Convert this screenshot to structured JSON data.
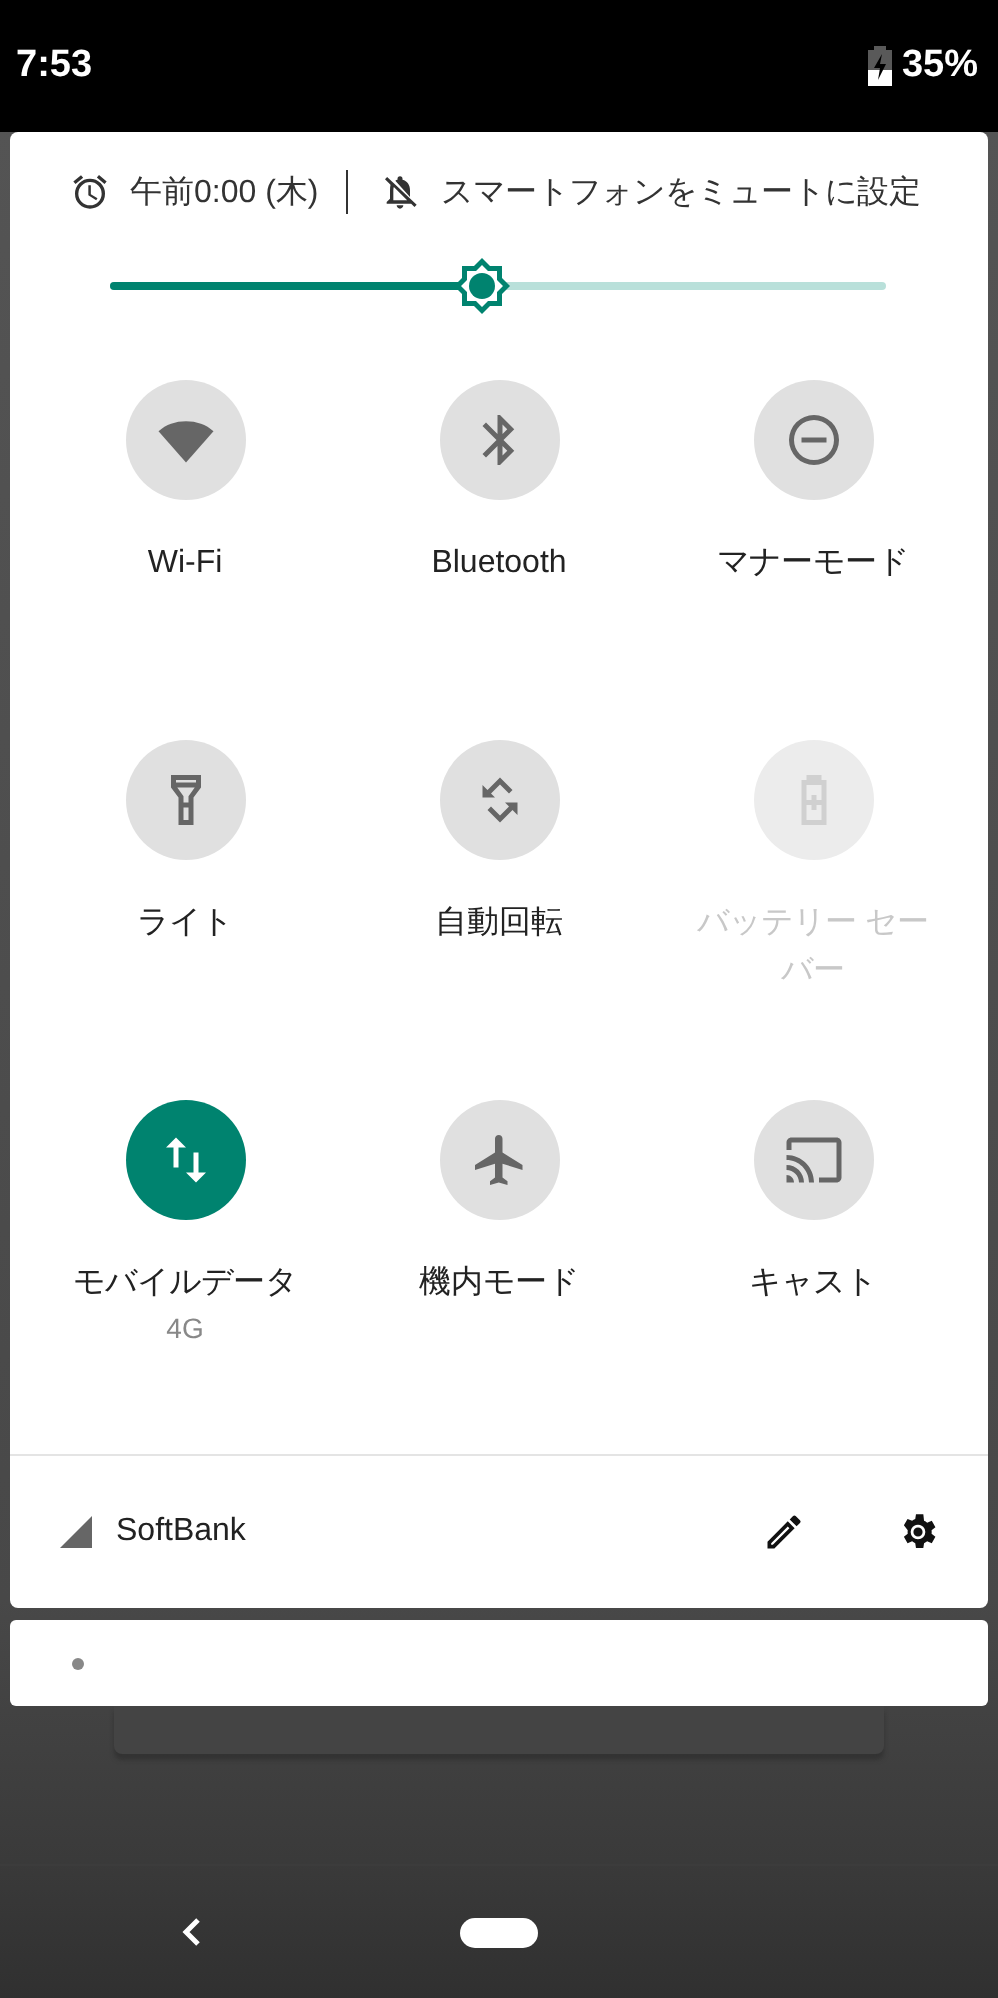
{
  "status_bar": {
    "time": "7:53",
    "battery": "35%"
  },
  "header": {
    "alarm": "午前0:00 (木)",
    "ringer": "スマートフォンをミュートに設定"
  },
  "brightness": {
    "level": 0.48
  },
  "tiles": [
    {
      "kind": "wifi",
      "label": "Wi-Fi",
      "on": false,
      "disabled": false
    },
    {
      "kind": "bluetooth",
      "label": "Bluetooth",
      "on": false,
      "disabled": false
    },
    {
      "kind": "dnd",
      "label": "マナーモード",
      "on": false,
      "disabled": false
    },
    {
      "kind": "flashlight",
      "label": "ライト",
      "on": false,
      "disabled": false
    },
    {
      "kind": "rotate",
      "label": "自動回転",
      "on": false,
      "disabled": false
    },
    {
      "kind": "battery",
      "label": "バッテリー セーバー",
      "on": false,
      "disabled": true
    },
    {
      "kind": "data",
      "label": "モバイルデータ",
      "sublabel": "4G",
      "on": true,
      "disabled": false
    },
    {
      "kind": "airplane",
      "label": "機内モード",
      "on": false,
      "disabled": false
    },
    {
      "kind": "cast",
      "label": "キャスト",
      "on": false,
      "disabled": false
    }
  ],
  "footer": {
    "carrier": "SoftBank"
  }
}
